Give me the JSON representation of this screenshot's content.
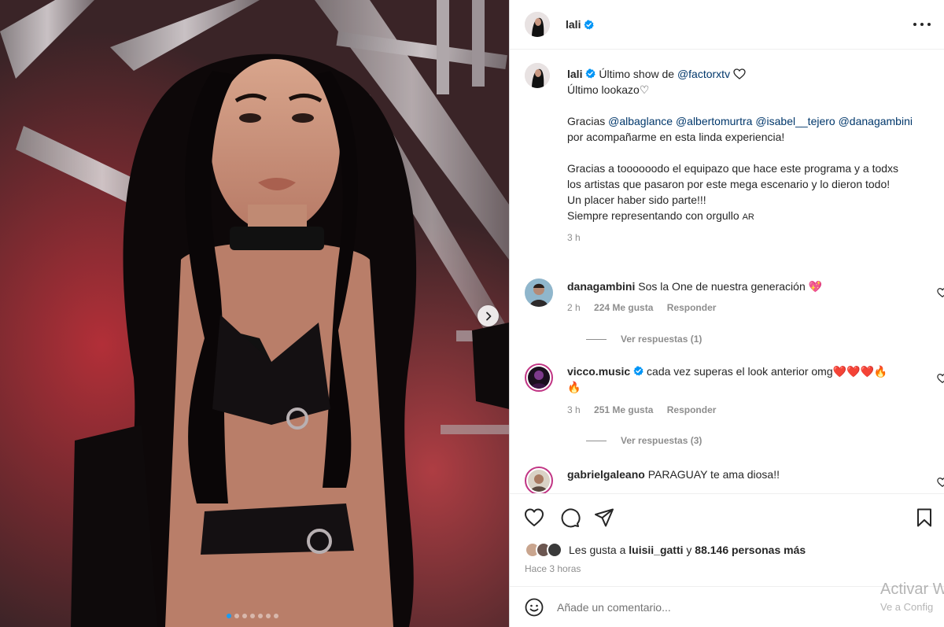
{
  "post": {
    "username": "lali",
    "verified": true,
    "photo_alt": "",
    "carousel": {
      "total": 7,
      "active": 0
    }
  },
  "caption": {
    "username": "lali",
    "line1_prefix": "Último show de ",
    "line1_mention": "@factorxtv",
    "line2": "Último lookazo♡",
    "thanks_prefix": "Gracias ",
    "mentions": [
      "@albaglance",
      "@albertomurtra",
      "@isabel__tejero",
      "@danagambini"
    ],
    "thanks_suffix": " por acompañarme en esta linda experiencia!",
    "para2": "Gracias a toooooodo el equipazo que hace este programa y a todxs los artistas que pasaron por este mega escenario y lo dieron todo!",
    "para3": "Un placer haber sido parte!!!",
    "para4": "Siempre representando con orgullo",
    "flag": "AR",
    "time": "3 h"
  },
  "comments": [
    {
      "username": "danagambini",
      "verified": false,
      "text": "Sos la One de nuestra generación 💖",
      "time": "2 h",
      "likes": "224 Me gusta",
      "reply": "Responder",
      "view_replies": "Ver respuestas (1)"
    },
    {
      "username": "vicco.music",
      "verified": true,
      "text": "cada vez superas el look anterior omg❤️❤️❤️🔥🔥",
      "time": "3 h",
      "likes": "251 Me gusta",
      "reply": "Responder",
      "view_replies": "Ver respuestas (3)"
    },
    {
      "username": "gabrielgaleano",
      "verified": false,
      "text": "PARAGUAY te ama diosa!!"
    }
  ],
  "likes": {
    "prefix": "Les gusta a ",
    "user": "luisii_gatti",
    "middle": " y ",
    "count": "88.146 personas más",
    "time_ago": "Hace 3 horas"
  },
  "add_comment": {
    "placeholder": "Añade un comentario..."
  },
  "icons": {
    "verified": "verified-badge-icon",
    "more": "more-options-icon",
    "like": "heart-icon",
    "comment": "comment-icon",
    "share": "share-icon",
    "save": "bookmark-icon",
    "emoji": "emoji-icon",
    "next": "chevron-right-icon"
  },
  "colors": {
    "accent_blue": "#0095f6",
    "mention": "#00376b",
    "muted": "#8e8e8e"
  },
  "watermark": {
    "line1": "Activar W",
    "line2": "Ve a Config"
  }
}
